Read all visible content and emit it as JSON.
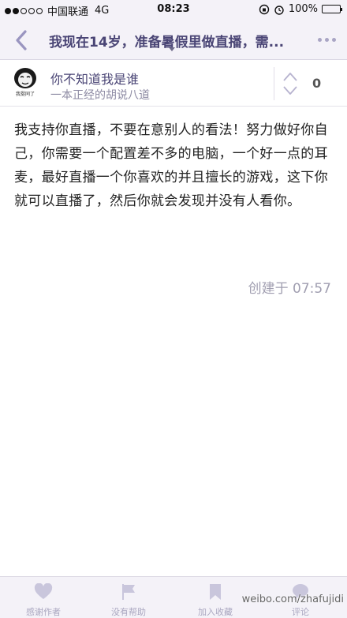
{
  "status_bar": {
    "carrier": "中国联通",
    "network": "4G",
    "time": "08:23",
    "battery": "100%"
  },
  "nav": {
    "title": "我现在14岁，准备暑假里做直播，需...",
    "back_icon": "chevron-left-icon",
    "more_icon": "more-dots-icon"
  },
  "author": {
    "name": "你不知道我是谁",
    "bio": "一本正经的胡说八道",
    "avatar_caption": "我挺同了",
    "vote_count": "0"
  },
  "answer": {
    "text": "我支持你直播，不要在意别人的看法！努力做好你自己，你需要一个配置差不多的电脑，一个好一点的耳麦，最好直播一个你喜欢的并且擅长的游戏，这下你就可以直播了，然后你就会发现并没有人看你。",
    "created": "创建于 07:57"
  },
  "toolbar": {
    "thank_label": "感谢作者",
    "no_help_label": "没有帮助",
    "collect_label": "加入收藏",
    "comment_label": "评论"
  },
  "watermark": "weibo.com/zhafujidi",
  "colors": {
    "accent": "#4a4575",
    "bar_bg": "#f4f2f8",
    "muted": "#aaa7c0"
  }
}
